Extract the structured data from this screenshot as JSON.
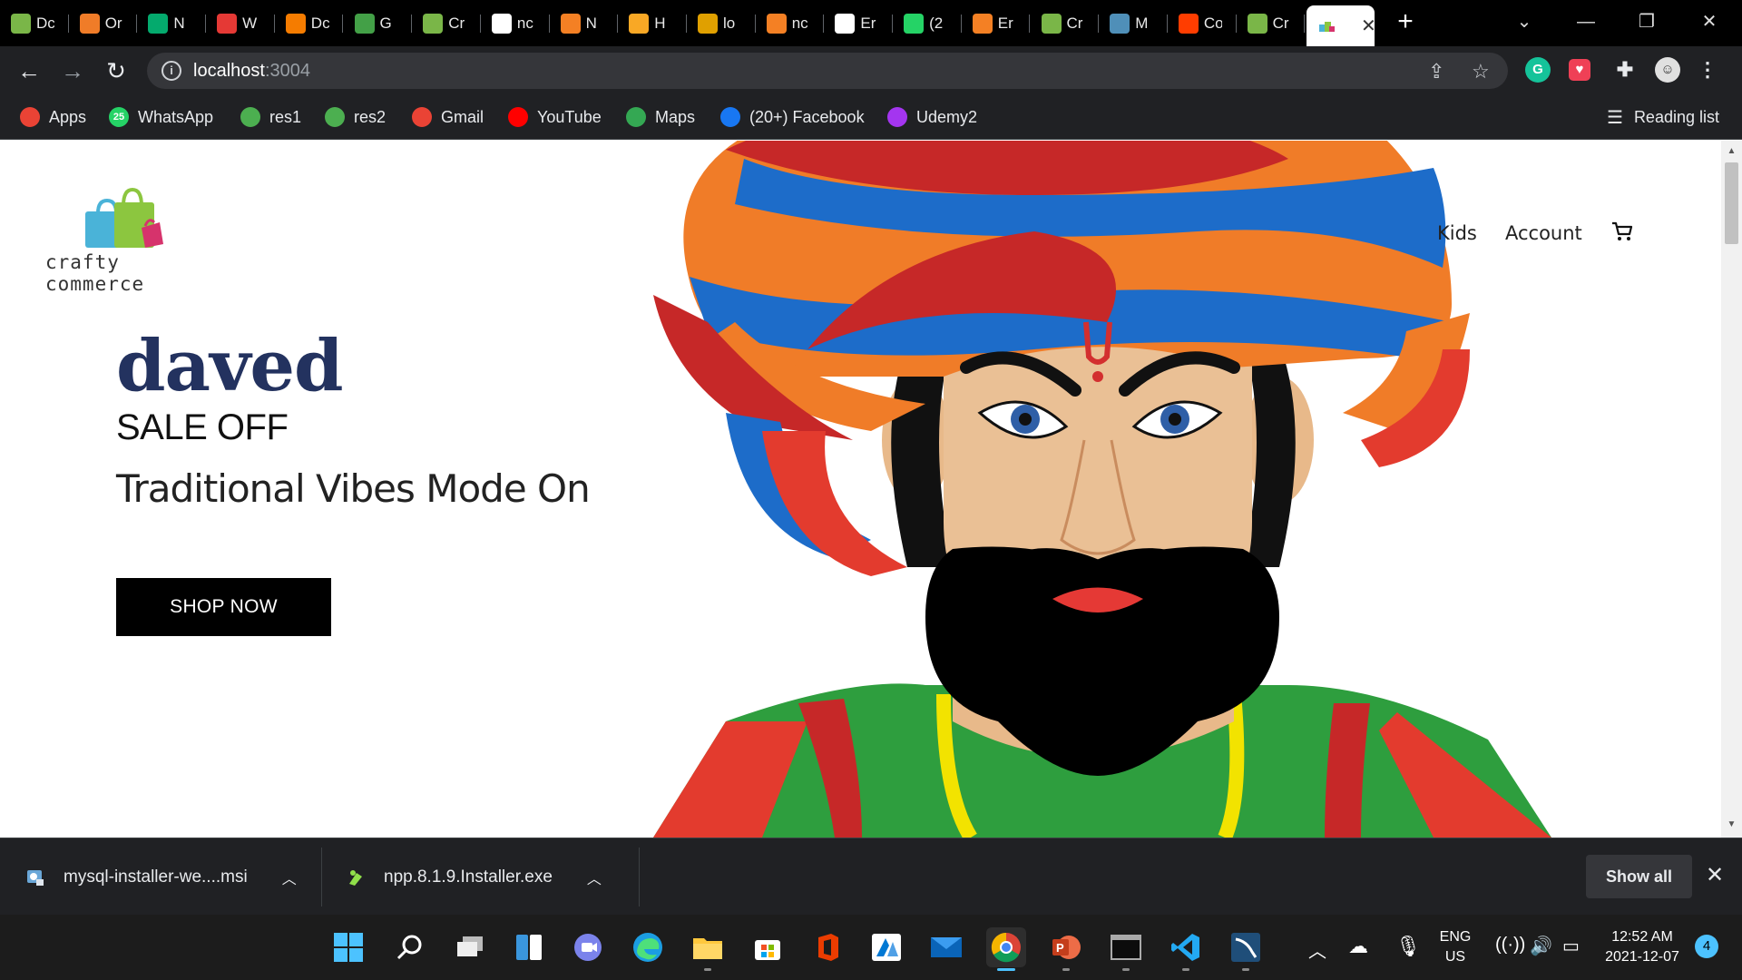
{
  "browser": {
    "tabs": [
      {
        "title": "Dc",
        "icon": "crafty-commerce-icon",
        "color": "#7ab648"
      },
      {
        "title": "Or",
        "icon": "flower-icon",
        "color": "#f07c28"
      },
      {
        "title": "N",
        "icon": "w3schools-icon",
        "color": "#04aa6d"
      },
      {
        "title": "W",
        "icon": "alert-icon",
        "color": "#e53935"
      },
      {
        "title": "Dc",
        "icon": "rss-icon",
        "color": "#f57c00"
      },
      {
        "title": "G",
        "icon": "node-icon",
        "color": "#43a047"
      },
      {
        "title": "Cr",
        "icon": "crafty-commerce-icon",
        "color": "#7ab648"
      },
      {
        "title": "nc",
        "icon": "google-icon",
        "color": "#ffffff"
      },
      {
        "title": "N",
        "icon": "stackoverflow-icon",
        "color": "#f48024"
      },
      {
        "title": "H",
        "icon": "book-icon",
        "color": "#f9a825"
      },
      {
        "title": "lo",
        "icon": "mountain-icon",
        "color": "#e0a000"
      },
      {
        "title": "nc",
        "icon": "stackoverflow-icon",
        "color": "#f48024"
      },
      {
        "title": "Er",
        "icon": "github-icon",
        "color": "#ffffff"
      },
      {
        "title": "(2",
        "icon": "whatsapp-icon",
        "color": "#25d366"
      },
      {
        "title": "Er",
        "icon": "stackoverflow-icon",
        "color": "#f48024"
      },
      {
        "title": "Cr",
        "icon": "crafty-commerce-icon",
        "color": "#7ab648"
      },
      {
        "title": "M",
        "icon": "mysql-icon",
        "color": "#4f8fb8"
      },
      {
        "title": "Co",
        "icon": "material-icon",
        "color": "#ff3d00"
      },
      {
        "title": "Cr",
        "icon": "crafty-commerce-icon",
        "color": "#7ab648"
      }
    ],
    "url_host": "localhost",
    "url_port": ":3004",
    "bookmarks": [
      {
        "label": "Apps",
        "icon": "apps-grid-icon",
        "color": "#ea4335"
      },
      {
        "label": "WhatsApp",
        "icon": "whatsapp-icon",
        "color": "#25d366",
        "badge": "25"
      },
      {
        "label": "res1",
        "icon": "leaf-icon",
        "color": "#4caf50"
      },
      {
        "label": "res2",
        "icon": "leaf-icon",
        "color": "#4caf50"
      },
      {
        "label": "Gmail",
        "icon": "gmail-icon",
        "color": "#ea4335"
      },
      {
        "label": "YouTube",
        "icon": "youtube-icon",
        "color": "#ff0000"
      },
      {
        "label": "Maps",
        "icon": "maps-pin-icon",
        "color": "#34a853"
      },
      {
        "label": "(20+) Facebook",
        "icon": "facebook-icon",
        "color": "#1877f2"
      },
      {
        "label": "Udemy2",
        "icon": "udemy-icon",
        "color": "#a435f0"
      }
    ],
    "reading_list": "Reading list"
  },
  "site": {
    "logo_name": "crafty commerce",
    "nav": {
      "kids": "Kids",
      "account": "Account"
    },
    "hero": {
      "brand": "daved",
      "sale": "SALE OFF",
      "tagline": "Traditional Vibes Mode On",
      "cta": "SHOP NOW"
    }
  },
  "downloads": {
    "items": [
      {
        "name": "mysql-installer-we....msi",
        "icon": "msi-installer-icon"
      },
      {
        "name": "npp.8.1.9.Installer.exe",
        "icon": "notepadpp-icon"
      }
    ],
    "show_all": "Show all"
  },
  "taskbar": {
    "apps": [
      "start-icon",
      "search-icon",
      "task-view-icon",
      "widgets-icon",
      "teams-chat-icon",
      "edge-icon",
      "file-explorer-icon",
      "store-icon",
      "office-icon",
      "azure-data-studio-icon",
      "mail-icon",
      "chrome-icon",
      "powerpoint-icon",
      "terminal-icon",
      "vscode-icon",
      "mysql-workbench-icon"
    ],
    "lang_top": "ENG",
    "lang_bottom": "US",
    "time": "12:52 AM",
    "date": "2021-12-07",
    "notification_count": "4"
  }
}
